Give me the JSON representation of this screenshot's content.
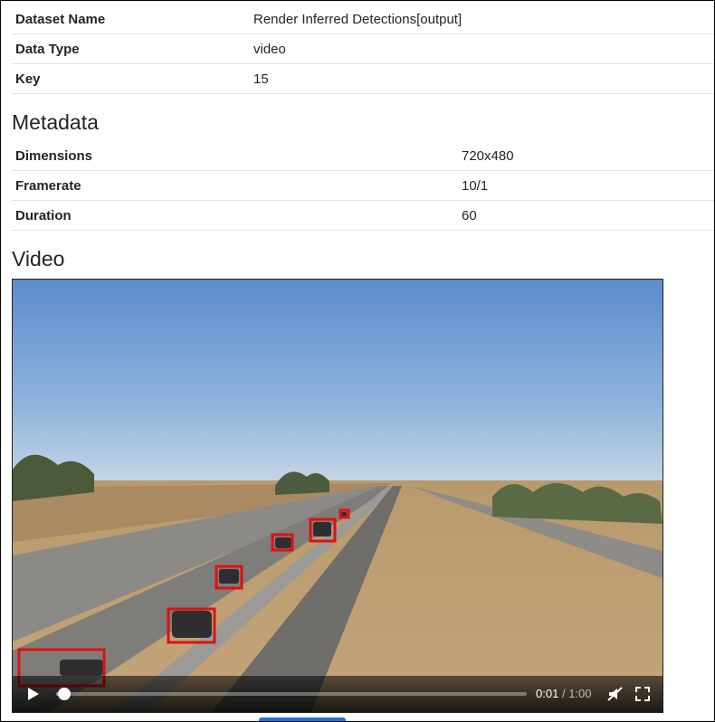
{
  "info": {
    "rows": [
      {
        "label": "Dataset Name",
        "value": "Render Inferred Detections[output]"
      },
      {
        "label": "Data Type",
        "value": "video"
      },
      {
        "label": "Key",
        "value": "15"
      }
    ]
  },
  "metadata": {
    "heading": "Metadata",
    "rows": [
      {
        "label": "Dimensions",
        "value": "720x480"
      },
      {
        "label": "Framerate",
        "value": "10/1"
      },
      {
        "label": "Duration",
        "value": "60"
      }
    ]
  },
  "video": {
    "heading": "Video",
    "player": {
      "current_time": "0:01",
      "separator": "/",
      "duration": "1:00",
      "progress": 0.017,
      "muted": true,
      "icons": {
        "play": "play-icon",
        "mute": "volume-muted-icon",
        "fullscreen": "fullscreen-icon"
      }
    },
    "detection_box_color": "#e01010"
  },
  "colors": {
    "accent": "#1a73e8",
    "seek_fill": "#4aa3ff"
  }
}
